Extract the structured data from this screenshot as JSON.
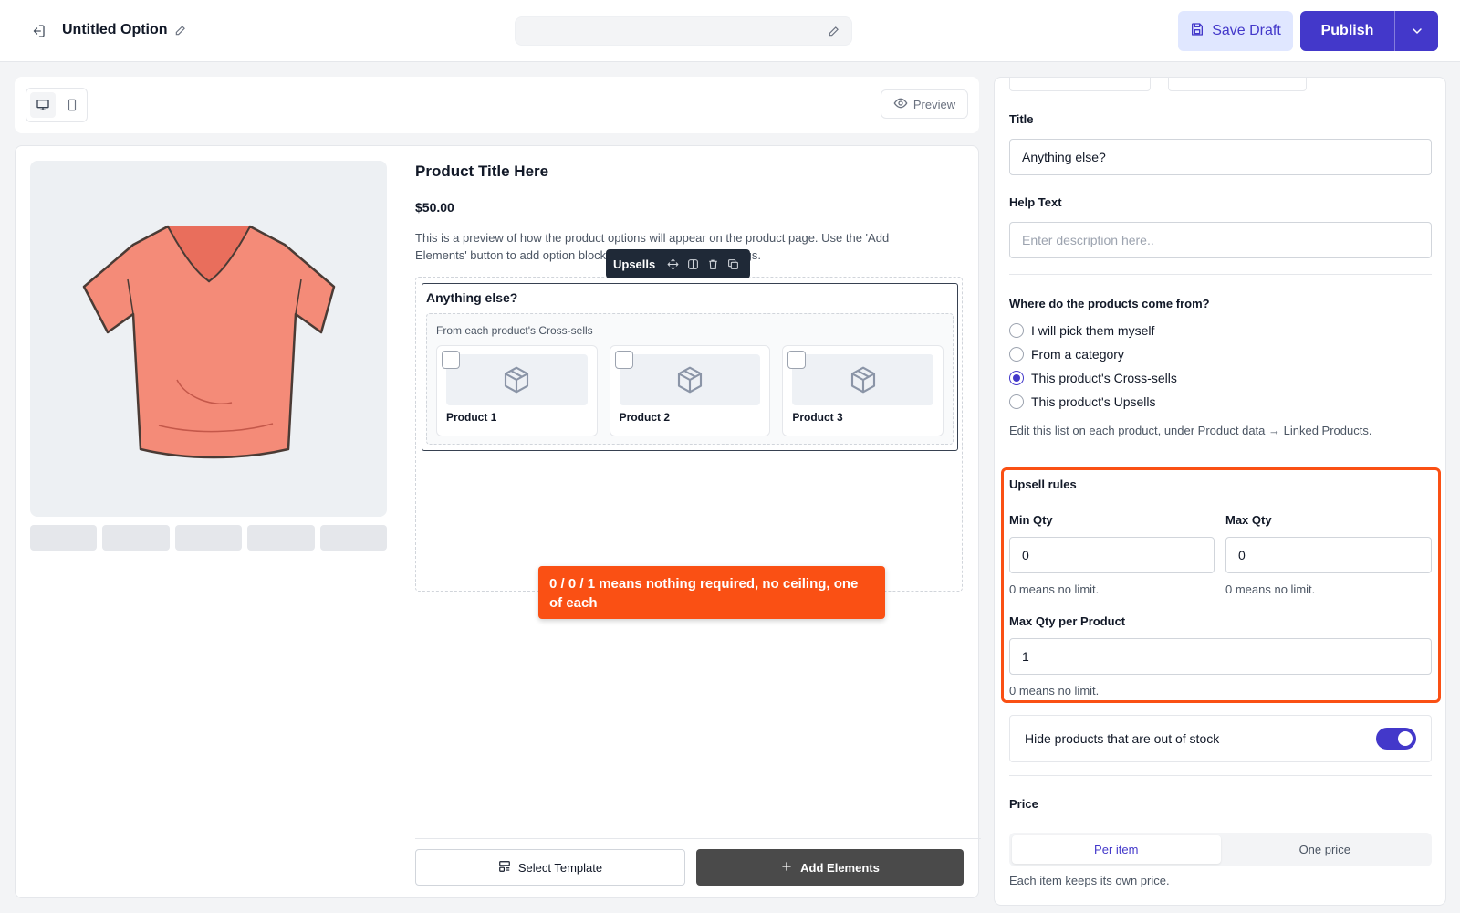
{
  "header": {
    "title": "Untitled Option",
    "save_draft_label": "Save Draft",
    "publish_label": "Publish"
  },
  "toolbar": {
    "preview_label": "Preview"
  },
  "product": {
    "title": "Product Title Here",
    "price": "$50.00",
    "description": "This is a preview of how the product options will appear on the product page. Use the 'Add Elements' button to add option blocks and configure their settings."
  },
  "block": {
    "toolbar_label": "Upsells",
    "title": "Anything else?",
    "source_label": "From each product's Cross-sells",
    "products": [
      {
        "label": "Product 1"
      },
      {
        "label": "Product 2"
      },
      {
        "label": "Product 3"
      }
    ]
  },
  "callout": {
    "text": "0 / 0 / 1 means nothing required, no ceiling, one of each"
  },
  "footer": {
    "select_template_label": "Select Template",
    "add_elements_label": "Add Elements"
  },
  "settings": {
    "title_label": "Title",
    "title_value": "Anything else?",
    "help_label": "Help Text",
    "help_placeholder": "Enter description here..",
    "source_question": "Where do the products come from?",
    "source_options": [
      {
        "label": "I will pick them myself",
        "checked": false
      },
      {
        "label": "From a category",
        "checked": false
      },
      {
        "label": "This product's Cross-sells",
        "checked": true
      },
      {
        "label": "This product's Upsells",
        "checked": false
      }
    ],
    "source_hint": "Edit this list on each product, under Product data → Linked Products.",
    "rules_label": "Upsell rules",
    "min_qty_label": "Min Qty",
    "min_qty_value": "0",
    "min_qty_hint": "0 means no limit.",
    "max_qty_label": "Max Qty",
    "max_qty_value": "0",
    "max_qty_hint": "0 means no limit.",
    "max_per_product_label": "Max Qty per Product",
    "max_per_product_value": "1",
    "max_per_product_hint": "0 means no limit.",
    "hide_oos_label": "Hide products that are out of stock",
    "hide_oos_enabled": true,
    "price_label": "Price",
    "price_options": [
      "Per item",
      "One price"
    ],
    "price_selected": "Per item",
    "price_hint": "Each item keeps its own price."
  },
  "colors": {
    "accent": "#4338ca",
    "highlight": "#fa5014"
  }
}
